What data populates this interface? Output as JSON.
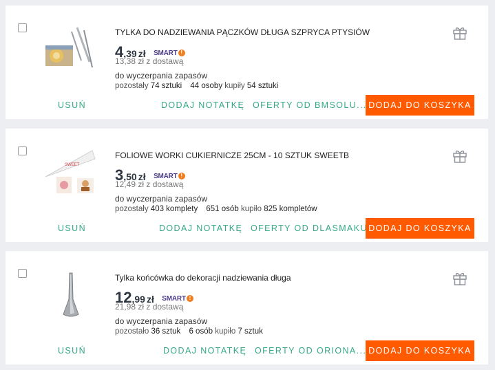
{
  "items": [
    {
      "title": "TYLKA DO NADZIEWANIA PĄCZKÓW DŁUGA SZPRYCA PTYSIÓW",
      "price_int": "4",
      "price_dec": ",39",
      "currency": "zł",
      "smart_label": "SMART",
      "smart_mark": "!",
      "delivery_price": "13,38 zł z dostawą",
      "availability": "do wyczerpania zapasów",
      "remaining_prefix": "pozostały",
      "remaining_qty": "74 sztuki",
      "buyers": "44 osoby",
      "bought_word": "kupiły",
      "bought_qty": "54 sztuki",
      "remove_label": "USUŃ",
      "note_label": "DODAJ NOTATKĘ",
      "offers_label": "OFERTY OD BMSOLU...",
      "cart_label": "DODAJ DO KOSZYKA"
    },
    {
      "title": "FOLIOWE WORKI CUKIERNICZE 25CM - 10 SZTUK SWEETB",
      "price_int": "3",
      "price_dec": ",50",
      "currency": "zł",
      "smart_label": "SMART",
      "smart_mark": "!",
      "delivery_price": "12,49 zł z dostawą",
      "availability": "do wyczerpania zapasów",
      "remaining_prefix": "pozostały",
      "remaining_qty": "403 komplety",
      "buyers": "651 osób",
      "bought_word": "kupiło",
      "bought_qty": "825 kompletów",
      "remove_label": "USUŃ",
      "note_label": "DODAJ NOTATKĘ",
      "offers_label": "OFERTY OD DLASMAKU",
      "cart_label": "DODAJ DO KOSZYKA"
    },
    {
      "title": "Tylka końcówka do dekoracji nadziewania długa",
      "price_int": "12",
      "price_dec": ",99",
      "currency": "zł",
      "smart_label": "SMART",
      "smart_mark": "!",
      "delivery_price": "21,98 zł z dostawą",
      "availability": "do wyczerpania zapasów",
      "remaining_prefix": "pozostało",
      "remaining_qty": "36 sztuk",
      "buyers": "6 osób",
      "bought_word": "kupiło",
      "bought_qty": "7 sztuk",
      "remove_label": "USUŃ",
      "note_label": "DODAJ NOTATKĘ",
      "offers_label": "OFERTY OD ORIONA...",
      "cart_label": "DODAJ DO KOSZYKA"
    }
  ],
  "colors": {
    "accent_green": "#35a888",
    "cart_orange": "#ff5a00",
    "smart_purple": "#4d3d8c",
    "smart_orange": "#f07c1e",
    "background": "#eceef1"
  },
  "icons": [
    "gift-icon",
    "checkbox"
  ]
}
